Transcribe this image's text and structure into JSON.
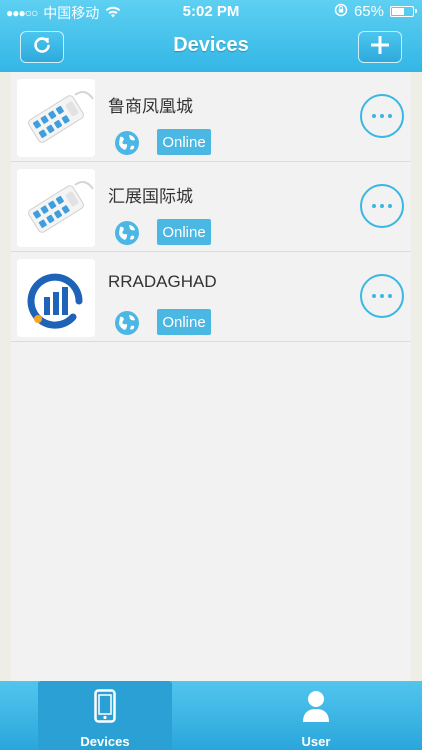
{
  "status_bar": {
    "signal": "●●●○○",
    "carrier": "中国移动",
    "time": "5:02 PM",
    "battery": "65%",
    "battery_level": 0.65
  },
  "nav": {
    "title": "Devices",
    "refresh_icon": "refresh-icon",
    "add_icon": "plus-icon"
  },
  "devices": [
    {
      "name": "鲁商凤凰城",
      "status": "Online",
      "image": "power-strip"
    },
    {
      "name": "汇展国际城",
      "status": "Online",
      "image": "power-strip"
    },
    {
      "name": "RRADAGHAD",
      "status": "Online",
      "image": "logo"
    }
  ],
  "tabs": [
    {
      "label": "Devices",
      "icon": "phone-icon",
      "selected": true
    },
    {
      "label": "User",
      "icon": "user-icon",
      "selected": false
    }
  ],
  "colors": {
    "accent": "#39b7e3",
    "header": "#33b6e6",
    "badge": "#4bb8e4"
  }
}
